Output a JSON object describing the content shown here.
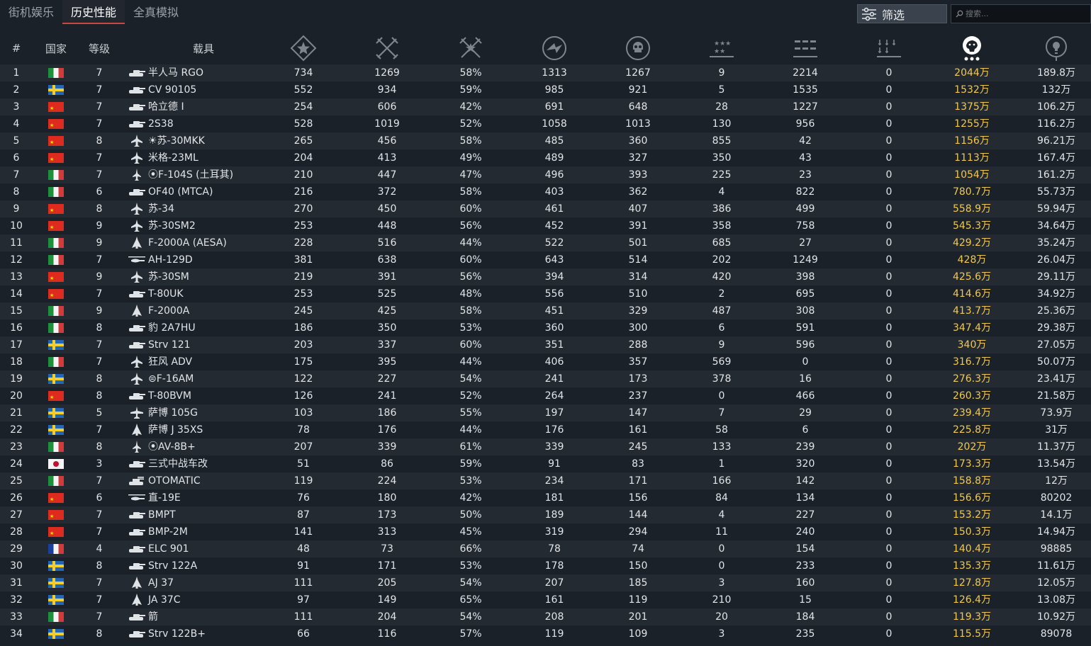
{
  "tabs": [
    {
      "label": "街机娱乐",
      "active": false
    },
    {
      "label": "历史性能",
      "active": true
    },
    {
      "label": "全真模拟",
      "active": false
    }
  ],
  "filter": {
    "label": "筛选",
    "icon": "sliders-icon"
  },
  "search": {
    "placeholder": "搜索..."
  },
  "columns": {
    "index": "#",
    "nation": "国家",
    "rank": "等级",
    "vehicle": "载具",
    "icons": [
      "battles-icon",
      "victories-icon",
      "win-rate-icon",
      "respawns-icon",
      "deaths-icon",
      "air-kills-icon",
      "ground-kills-icon",
      "naval-kills-icon",
      "lion-icon",
      "research-icon"
    ]
  },
  "accent_color": "#f2c94c",
  "rows": [
    {
      "idx": "1",
      "nation": "it",
      "rank": "7",
      "type": "tank",
      "name": "半人马 RGO",
      "a": "734",
      "b": "1269",
      "c": "58%",
      "d": "1313",
      "e": "1267",
      "f": "9",
      "g": "2214",
      "h": "0",
      "i": "2044万",
      "j": "189.8万"
    },
    {
      "idx": "2",
      "nation": "se",
      "rank": "7",
      "type": "tank",
      "name": "CV 90105",
      "a": "552",
      "b": "934",
      "c": "59%",
      "d": "985",
      "e": "921",
      "f": "5",
      "g": "1535",
      "h": "0",
      "i": "1532万",
      "j": "132万"
    },
    {
      "idx": "3",
      "nation": "cn",
      "rank": "7",
      "type": "tank",
      "name": "哈立德 I",
      "a": "254",
      "b": "606",
      "c": "42%",
      "d": "691",
      "e": "648",
      "f": "28",
      "g": "1227",
      "h": "0",
      "i": "1375万",
      "j": "106.2万"
    },
    {
      "idx": "4",
      "nation": "cn",
      "rank": "7",
      "type": "tank",
      "name": "2S38",
      "a": "528",
      "b": "1019",
      "c": "52%",
      "d": "1058",
      "e": "1013",
      "f": "130",
      "g": "956",
      "h": "0",
      "i": "1255万",
      "j": "116.2万"
    },
    {
      "idx": "5",
      "nation": "cn",
      "rank": "8",
      "type": "jet",
      "name": "☀苏-30MKK",
      "a": "265",
      "b": "456",
      "c": "58%",
      "d": "485",
      "e": "360",
      "f": "855",
      "g": "42",
      "h": "0",
      "i": "1156万",
      "j": "96.21万"
    },
    {
      "idx": "6",
      "nation": "cn",
      "rank": "7",
      "type": "jet",
      "name": "米格-23ML",
      "a": "204",
      "b": "413",
      "c": "49%",
      "d": "489",
      "e": "327",
      "f": "350",
      "g": "43",
      "h": "0",
      "i": "1113万",
      "j": "167.4万"
    },
    {
      "idx": "7",
      "nation": "it",
      "rank": "7",
      "type": "jet2",
      "name": "⦿F-104S (土耳其)",
      "a": "210",
      "b": "447",
      "c": "47%",
      "d": "496",
      "e": "393",
      "f": "225",
      "g": "23",
      "h": "0",
      "i": "1054万",
      "j": "161.2万"
    },
    {
      "idx": "8",
      "nation": "it",
      "rank": "6",
      "type": "tank",
      "name": "OF40 (MTCA)",
      "a": "216",
      "b": "372",
      "c": "58%",
      "d": "403",
      "e": "362",
      "f": "4",
      "g": "822",
      "h": "0",
      "i": "780.7万",
      "j": "55.73万"
    },
    {
      "idx": "9",
      "nation": "cn",
      "rank": "8",
      "type": "jet",
      "name": "苏-34",
      "a": "270",
      "b": "450",
      "c": "60%",
      "d": "461",
      "e": "407",
      "f": "386",
      "g": "499",
      "h": "0",
      "i": "558.9万",
      "j": "59.94万"
    },
    {
      "idx": "10",
      "nation": "cn",
      "rank": "9",
      "type": "jet",
      "name": "苏-30SM2",
      "a": "253",
      "b": "448",
      "c": "56%",
      "d": "452",
      "e": "391",
      "f": "358",
      "g": "758",
      "h": "0",
      "i": "545.3万",
      "j": "34.64万"
    },
    {
      "idx": "11",
      "nation": "it",
      "rank": "9",
      "type": "delta",
      "name": "F-2000A (AESA)",
      "a": "228",
      "b": "516",
      "c": "44%",
      "d": "522",
      "e": "501",
      "f": "685",
      "g": "27",
      "h": "0",
      "i": "429.2万",
      "j": "35.24万"
    },
    {
      "idx": "12",
      "nation": "it",
      "rank": "7",
      "type": "heli",
      "name": "AH-129D",
      "a": "381",
      "b": "638",
      "c": "60%",
      "d": "643",
      "e": "514",
      "f": "202",
      "g": "1249",
      "h": "0",
      "i": "428万",
      "j": "26.04万"
    },
    {
      "idx": "13",
      "nation": "cn",
      "rank": "9",
      "type": "jet",
      "name": "苏-30SM",
      "a": "219",
      "b": "391",
      "c": "56%",
      "d": "394",
      "e": "314",
      "f": "420",
      "g": "398",
      "h": "0",
      "i": "425.6万",
      "j": "29.11万"
    },
    {
      "idx": "14",
      "nation": "cn",
      "rank": "7",
      "type": "tank",
      "name": "T-80UK",
      "a": "253",
      "b": "525",
      "c": "48%",
      "d": "556",
      "e": "510",
      "f": "2",
      "g": "695",
      "h": "0",
      "i": "414.6万",
      "j": "34.92万"
    },
    {
      "idx": "15",
      "nation": "it",
      "rank": "9",
      "type": "delta",
      "name": "F-2000A",
      "a": "245",
      "b": "425",
      "c": "58%",
      "d": "451",
      "e": "329",
      "f": "487",
      "g": "308",
      "h": "0",
      "i": "413.7万",
      "j": "25.36万"
    },
    {
      "idx": "16",
      "nation": "it",
      "rank": "8",
      "type": "tank",
      "name": "豹 2A7HU",
      "a": "186",
      "b": "350",
      "c": "53%",
      "d": "360",
      "e": "300",
      "f": "6",
      "g": "591",
      "h": "0",
      "i": "347.4万",
      "j": "29.38万"
    },
    {
      "idx": "17",
      "nation": "se",
      "rank": "7",
      "type": "tank",
      "name": "Strv 121",
      "a": "203",
      "b": "337",
      "c": "60%",
      "d": "351",
      "e": "288",
      "f": "9",
      "g": "596",
      "h": "0",
      "i": "340万",
      "j": "27.05万"
    },
    {
      "idx": "18",
      "nation": "it",
      "rank": "7",
      "type": "jet",
      "name": "狂风 ADV",
      "a": "175",
      "b": "395",
      "c": "44%",
      "d": "406",
      "e": "357",
      "f": "569",
      "g": "0",
      "h": "0",
      "i": "316.7万",
      "j": "50.07万"
    },
    {
      "idx": "19",
      "nation": "se",
      "rank": "8",
      "type": "jet",
      "name": "⊜F-16AM",
      "a": "122",
      "b": "227",
      "c": "54%",
      "d": "241",
      "e": "173",
      "f": "378",
      "g": "16",
      "h": "0",
      "i": "276.3万",
      "j": "23.41万"
    },
    {
      "idx": "20",
      "nation": "cn",
      "rank": "8",
      "type": "tank",
      "name": "T-80BVM",
      "a": "126",
      "b": "241",
      "c": "52%",
      "d": "264",
      "e": "237",
      "f": "0",
      "g": "466",
      "h": "0",
      "i": "260.3万",
      "j": "21.58万"
    },
    {
      "idx": "21",
      "nation": "se",
      "rank": "5",
      "type": "plane",
      "name": "萨博 105G",
      "a": "103",
      "b": "186",
      "c": "55%",
      "d": "197",
      "e": "147",
      "f": "7",
      "g": "29",
      "h": "0",
      "i": "239.4万",
      "j": "73.9万"
    },
    {
      "idx": "22",
      "nation": "se",
      "rank": "7",
      "type": "delta",
      "name": "萨博 J 35XS",
      "a": "78",
      "b": "176",
      "c": "44%",
      "d": "176",
      "e": "161",
      "f": "58",
      "g": "6",
      "h": "0",
      "i": "225.8万",
      "j": "31万"
    },
    {
      "idx": "23",
      "nation": "it",
      "rank": "8",
      "type": "jet2",
      "name": "⦿AV-8B+",
      "a": "207",
      "b": "339",
      "c": "61%",
      "d": "339",
      "e": "245",
      "f": "133",
      "g": "239",
      "h": "0",
      "i": "202万",
      "j": "11.37万"
    },
    {
      "idx": "24",
      "nation": "jp",
      "rank": "3",
      "type": "tank",
      "name": "三式中战车改",
      "a": "51",
      "b": "86",
      "c": "59%",
      "d": "91",
      "e": "83",
      "f": "1",
      "g": "320",
      "h": "0",
      "i": "173.3万",
      "j": "13.54万"
    },
    {
      "idx": "25",
      "nation": "it",
      "rank": "7",
      "type": "spaa",
      "name": "OTOMATIC",
      "a": "119",
      "b": "224",
      "c": "53%",
      "d": "234",
      "e": "171",
      "f": "166",
      "g": "142",
      "h": "0",
      "i": "158.8万",
      "j": "12万"
    },
    {
      "idx": "26",
      "nation": "cn",
      "rank": "6",
      "type": "heli",
      "name": "直-19E",
      "a": "76",
      "b": "180",
      "c": "42%",
      "d": "181",
      "e": "156",
      "f": "84",
      "g": "134",
      "h": "0",
      "i": "156.6万",
      "j": "80202"
    },
    {
      "idx": "27",
      "nation": "cn",
      "rank": "7",
      "type": "tank",
      "name": "BMPT",
      "a": "87",
      "b": "173",
      "c": "50%",
      "d": "189",
      "e": "144",
      "f": "4",
      "g": "227",
      "h": "0",
      "i": "153.2万",
      "j": "14.1万"
    },
    {
      "idx": "28",
      "nation": "cn",
      "rank": "7",
      "type": "tank",
      "name": "BMP-2M",
      "a": "141",
      "b": "313",
      "c": "45%",
      "d": "319",
      "e": "294",
      "f": "11",
      "g": "240",
      "h": "0",
      "i": "150.3万",
      "j": "14.94万"
    },
    {
      "idx": "29",
      "nation": "fr",
      "rank": "4",
      "type": "tank",
      "name": "ELC 901",
      "a": "48",
      "b": "73",
      "c": "66%",
      "d": "78",
      "e": "74",
      "f": "0",
      "g": "154",
      "h": "0",
      "i": "140.4万",
      "j": "98885"
    },
    {
      "idx": "30",
      "nation": "se",
      "rank": "8",
      "type": "tank",
      "name": "Strv 122A",
      "a": "91",
      "b": "171",
      "c": "53%",
      "d": "178",
      "e": "150",
      "f": "0",
      "g": "233",
      "h": "0",
      "i": "135.3万",
      "j": "11.61万"
    },
    {
      "idx": "31",
      "nation": "se",
      "rank": "7",
      "type": "delta",
      "name": "AJ 37",
      "a": "111",
      "b": "205",
      "c": "54%",
      "d": "207",
      "e": "185",
      "f": "3",
      "g": "160",
      "h": "0",
      "i": "127.8万",
      "j": "12.05万"
    },
    {
      "idx": "32",
      "nation": "se",
      "rank": "7",
      "type": "delta",
      "name": "JA 37C",
      "a": "97",
      "b": "149",
      "c": "65%",
      "d": "161",
      "e": "119",
      "f": "210",
      "g": "15",
      "h": "0",
      "i": "126.4万",
      "j": "13.08万"
    },
    {
      "idx": "33",
      "nation": "it",
      "rank": "7",
      "type": "tank",
      "name": "箭",
      "a": "111",
      "b": "204",
      "c": "54%",
      "d": "208",
      "e": "201",
      "f": "20",
      "g": "184",
      "h": "0",
      "i": "119.3万",
      "j": "10.92万"
    },
    {
      "idx": "34",
      "nation": "se",
      "rank": "8",
      "type": "tank",
      "name": "Strv 122B+",
      "a": "66",
      "b": "116",
      "c": "57%",
      "d": "119",
      "e": "109",
      "f": "3",
      "g": "235",
      "h": "0",
      "i": "115.5万",
      "j": "89078"
    }
  ]
}
